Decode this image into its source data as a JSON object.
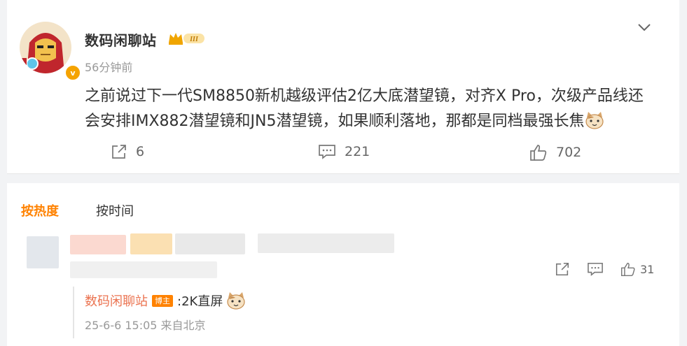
{
  "post": {
    "author": "数码闲聊站",
    "time": "56分钟前",
    "crown_level": "III",
    "verified_mark": "v",
    "line1": "之前说过下一代SM8850新机越级评估2亿大底潜望镜，对齐X Pro，次级产品线还",
    "line2": "会安排IMX882潜望镜和JN5潜望镜，如果顺利落地，那都是同档最强长焦",
    "emoji": "cat-emoji"
  },
  "actions": {
    "repost_count": "6",
    "comment_count": "221",
    "like_count": "702"
  },
  "sort": {
    "hot": "按热度",
    "time": "按时间"
  },
  "comment": {
    "like_count": "31"
  },
  "reply": {
    "author": "数码闲聊站",
    "badge": "博主",
    "text": ":2K直屏",
    "meta": "25-6-6 15:05 来自北京"
  },
  "colors": {
    "accent": "#ff8200",
    "reply_name": "#eb7350",
    "muted": "#999999",
    "badge_verified": "#f5a300"
  },
  "icons": [
    "repost-icon",
    "comment-icon",
    "like-icon",
    "chevron-down-icon",
    "crown-icon",
    "cat-emoji"
  ]
}
